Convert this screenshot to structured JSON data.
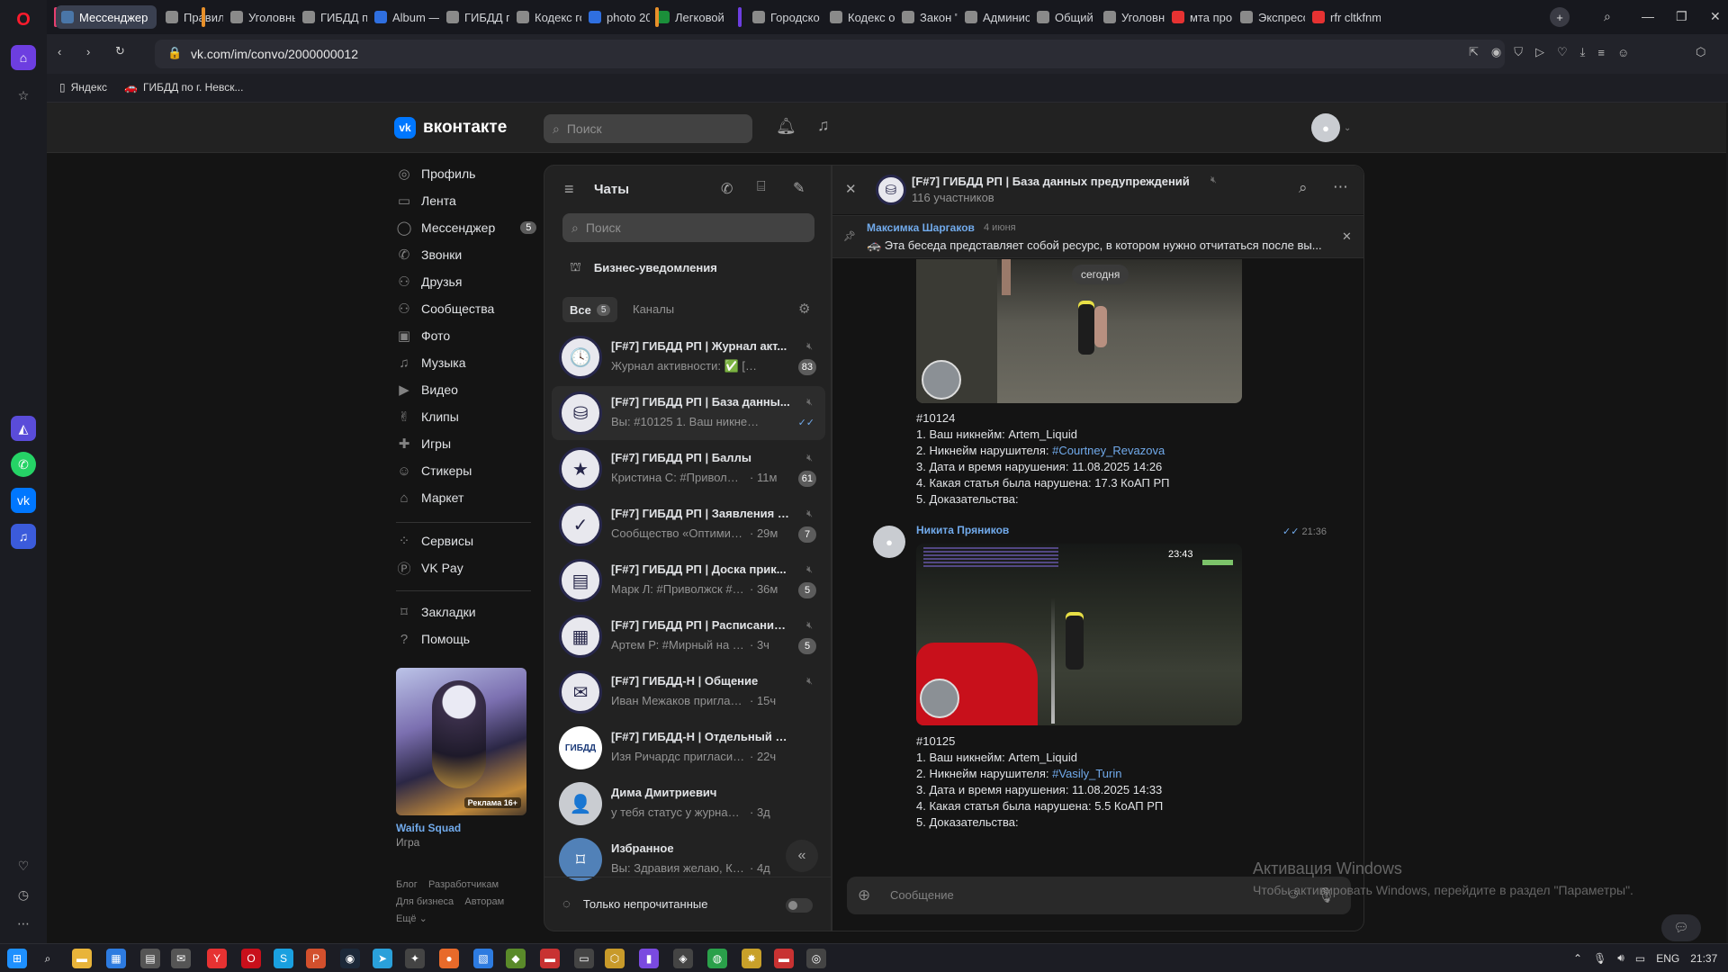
{
  "browser": {
    "tabs": [
      {
        "label": "Мессенджер",
        "active": true,
        "color": "#4a76a8"
      },
      {
        "label": "Правила д",
        "color": "#8a8a8a"
      },
      {
        "label": "Уголовны",
        "color": "#8a8a8a"
      },
      {
        "label": "ГИБДД по",
        "color": "#8a8a8a"
      },
      {
        "label": "Album —",
        "color": "#2f6fe0"
      },
      {
        "label": "ГИБДД по",
        "color": "#8a8a8a"
      },
      {
        "label": "Кодекс го",
        "color": "#8a8a8a"
      },
      {
        "label": "photo 202",
        "color": "#2f6fe0"
      },
      {
        "label": "Легковой",
        "color": "#1b8f3a"
      },
      {
        "label": "Городско",
        "color": "#8a8a8a"
      },
      {
        "label": "Кодекс об",
        "color": "#8a8a8a"
      },
      {
        "label": "Закон \"О",
        "color": "#8a8a8a"
      },
      {
        "label": "Админист",
        "color": "#8a8a8a"
      },
      {
        "label": "Общий и",
        "color": "#8a8a8a"
      },
      {
        "label": "Уголовны",
        "color": "#8a8a8a"
      },
      {
        "label": "мта прові",
        "color": "#e63232"
      },
      {
        "label": "Экспресс",
        "color": "#8a8a8a"
      },
      {
        "label": "rfr cltkfnm",
        "color": "#e63232"
      }
    ],
    "url": "vk.com/im/convo/2000000012",
    "bookmarks": [
      "Яндекс",
      "ГИБДД по г. Невск..."
    ]
  },
  "vk": {
    "logo": "вконтакте",
    "search_placeholder": "Поиск",
    "nav": [
      {
        "label": "Профиль",
        "icon": "profile-icon",
        "glyph": "◎"
      },
      {
        "label": "Лента",
        "icon": "feed-icon",
        "glyph": "▭"
      },
      {
        "label": "Мессенджер",
        "icon": "messenger-icon",
        "glyph": "◯",
        "badge": "5"
      },
      {
        "label": "Звонки",
        "icon": "phone-icon",
        "glyph": "✆"
      },
      {
        "label": "Друзья",
        "icon": "friends-icon",
        "glyph": "⚇"
      },
      {
        "label": "Сообщества",
        "icon": "communities-icon",
        "glyph": "⚇"
      },
      {
        "label": "Фото",
        "icon": "photo-icon",
        "glyph": "▣"
      },
      {
        "label": "Музыка",
        "icon": "music-icon",
        "glyph": "♫"
      },
      {
        "label": "Видео",
        "icon": "video-icon",
        "glyph": "▶"
      },
      {
        "label": "Клипы",
        "icon": "clips-icon",
        "glyph": "✌"
      },
      {
        "label": "Игры",
        "icon": "games-icon",
        "glyph": "✚"
      },
      {
        "label": "Стикеры",
        "icon": "stickers-icon",
        "glyph": "☺"
      },
      {
        "label": "Маркет",
        "icon": "market-icon",
        "glyph": "⌂"
      }
    ],
    "nav2": [
      {
        "label": "Сервисы",
        "icon": "services-icon",
        "glyph": "⁘"
      },
      {
        "label": "VK Pay",
        "icon": "vkpay-icon",
        "glyph": "Ⓟ"
      }
    ],
    "nav3": [
      {
        "label": "Закладки",
        "icon": "bookmarks-icon",
        "glyph": "⌑"
      },
      {
        "label": "Помощь",
        "icon": "help-icon",
        "glyph": "?"
      }
    ],
    "ad": {
      "badge": "Реклама 16+",
      "title": "Waifu Squad",
      "subtitle": "Игра"
    },
    "footer": {
      "blog": "Блог",
      "dev": "Разработчикам",
      "biz": "Для бизнеса",
      "authors": "Авторам",
      "more": "Ещё"
    }
  },
  "chats": {
    "title": "Чаты",
    "search_placeholder": "Поиск",
    "business": "Бизнес-уведомления",
    "filter_all": "Все",
    "filter_all_count": "5",
    "filter_channels": "Каналы",
    "items": [
      {
        "title": "[F#7] ГИБДД РП | Журнал акт...",
        "msg": "Журнал активности: ✅ [М-ЦП...",
        "badge": "83",
        "icon": "clock-icon",
        "glyph": "🕓",
        "muted": true
      },
      {
        "title": "[F#7] ГИБДД РП | База данны...",
        "msg": "Вы: #10125 1. Ваш никнейм: Ar...",
        "badge": "",
        "icon": "database-icon",
        "glyph": "⛁",
        "muted": true,
        "selected": true
      },
      {
        "title": "[F#7] ГИБДД РП | Баллы",
        "msg": "Кристина С: #Приволжс...",
        "time": "11м",
        "badge": "61",
        "icon": "star-icon",
        "glyph": "★",
        "muted": true
      },
      {
        "title": "[F#7] ГИБДД РП | Заявления н...",
        "msg": "Сообщество «Оптимизац...",
        "time": "29м",
        "badge": "7",
        "icon": "check-circle-icon",
        "glyph": "✓",
        "muted": true
      },
      {
        "title": "[F#7] ГИБДД РП | Доска прик...",
        "msg": "Марк Л: #Приволжск #Вз...",
        "time": "36м",
        "badge": "5",
        "icon": "document-icon",
        "glyph": "▤",
        "muted": true
      },
      {
        "title": "[F#7] ГИБДД РП | Расписание ...",
        "msg": "Артем Р: #Мирный на 12.0...",
        "time": "3ч",
        "badge": "5",
        "icon": "calendar-icon",
        "glyph": "▦",
        "muted": true
      },
      {
        "title": "[F#7] ГИБДД-Н | Общение",
        "msg": "Иван Межаков пригласил Гле...",
        "time": "15ч",
        "badge": "",
        "icon": "mail-icon",
        "glyph": "✉",
        "muted": true
      },
      {
        "title": "[F#7] ГИБДД-Н | Отдельный бата...",
        "msg": "Изя Ричардс пригласил Jerry ...",
        "time": "22ч",
        "badge": "",
        "icon": "gibdd-logo-icon",
        "glyph": "ГИБДД",
        "muted": false
      },
      {
        "title": "Дима Дмитриевич",
        "msg": "у тебя статус у журнале актин...",
        "time": "3д",
        "badge": "",
        "icon": "user-avatar-icon",
        "glyph": "👤",
        "muted": false
      },
      {
        "title": "Избранное",
        "msg": "Вы: Здравия желаю, Курса...",
        "time": "4д",
        "badge": "",
        "icon": "favorites-icon",
        "glyph": "⌑",
        "muted": false
      }
    ],
    "unread_only": "Только непрочитанные"
  },
  "conversation": {
    "title": "[F#7] ГИБДД РП | База данных предупреждений",
    "members": "116 участников",
    "pinned_author": "Максимка Шаргаков",
    "pinned_date": "4 июня",
    "pinned_text": "🚓 Эта беседа представляет собой ресурс, в котором нужно отчитаться после вы...",
    "date_chip": "сегодня",
    "msg1": {
      "id": "#10124",
      "l1": "1. Ваш никнейм: Artem_Liquid",
      "l2_prefix": "2. Никнейм нарушителя: ",
      "l2_link": "#Courtney_Revazova",
      "l3": "3. Дата и время нарушения: 11.08.2025 14:26",
      "l4": "4. Какая статья была нарушена: 17.3 КоАП РП",
      "l5": "5. Доказательства:"
    },
    "msg2": {
      "author": "Никита Пряников",
      "time": "21:36",
      "hud_time": "23:43",
      "id": "#10125",
      "l1": "1. Ваш никнейм: Artem_Liquid",
      "l2_prefix": "2. Никнейм нарушителя: ",
      "l2_link": "#Vasily_Turin",
      "l3": "3. Дата и время нарушения: 11.08.2025 14:33",
      "l4": "4. Какая статья была нарушена: 5.5 КоАП РП",
      "l5": "5. Доказательства:"
    },
    "input_placeholder": "Сообщение"
  },
  "windows": {
    "watermark_title": "Активация Windows",
    "watermark_text": "Чтобы активировать Windows, перейдите в раздел \"Параметры\".",
    "lang": "ENG",
    "clock": "21:37"
  }
}
